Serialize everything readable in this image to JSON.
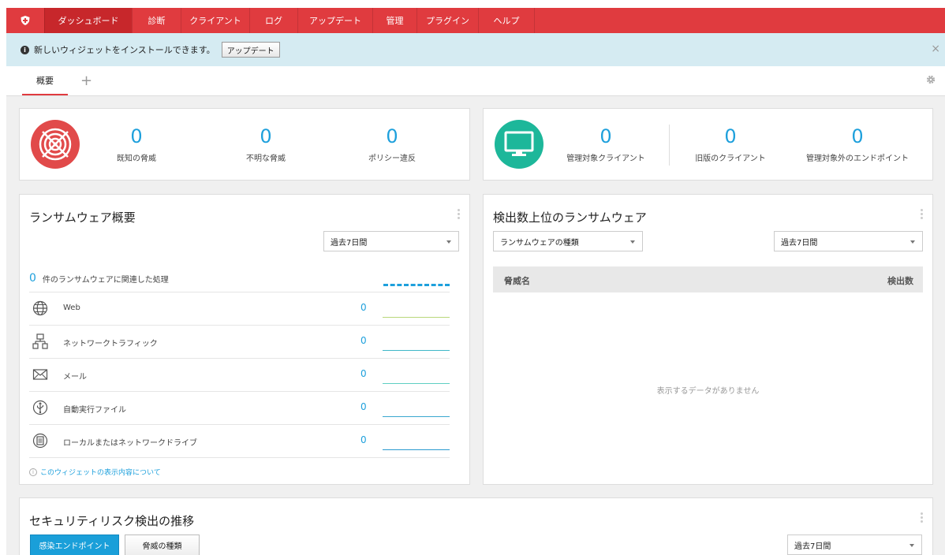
{
  "topnav": {
    "logo_icon": "shield-plus-icon",
    "items": [
      {
        "label": "ダッシュボード",
        "active": true
      },
      {
        "label": "診断"
      },
      {
        "label": "クライアント"
      },
      {
        "label": "ログ"
      },
      {
        "label": "アップデート"
      },
      {
        "label": "管理"
      },
      {
        "label": "プラグイン"
      },
      {
        "label": "ヘルプ"
      }
    ]
  },
  "infobar": {
    "icon": "info-icon",
    "message": "新しいウィジェットをインストールできます。",
    "button_label": "アップデート",
    "close_label": "×"
  },
  "tabs": {
    "overview_label": "概要",
    "add_label": "+"
  },
  "threat_summary": {
    "icon": "radar-icon",
    "stats": [
      {
        "value": "0",
        "label": "既知の脅威"
      },
      {
        "value": "0",
        "label": "不明な脅威"
      },
      {
        "value": "0",
        "label": "ポリシー違反"
      }
    ]
  },
  "client_summary": {
    "icon": "monitor-icon",
    "stats": [
      {
        "value": "0",
        "label": "管理対象クライアント"
      },
      {
        "value": "0",
        "label": "旧版のクライアント"
      },
      {
        "value": "0",
        "label": "管理対象外のエンドポイント"
      }
    ]
  },
  "ransomware_overview": {
    "title": "ランサムウェア概要",
    "period": "過去7日間",
    "total_value": "0",
    "total_label": "件のランサムウェアに関連した処理",
    "rows": [
      {
        "icon": "globe-icon",
        "label": "Web",
        "value": "0",
        "line_color": "#b9d77a"
      },
      {
        "icon": "network-icon",
        "label": "ネットワークトラフィック",
        "value": "0",
        "line_color": "#3fb8c8"
      },
      {
        "icon": "mail-icon",
        "label": "メール",
        "value": "0",
        "line_color": "#5fcfc2"
      },
      {
        "icon": "usb-icon",
        "label": "自動実行ファイル",
        "value": "0",
        "line_color": "#3aa8d0"
      },
      {
        "icon": "drive-icon",
        "label": "ローカルまたはネットワークドライブ",
        "value": "0",
        "line_color": "#2a9ad0"
      }
    ],
    "about_link": "このウィジェットの表示内容について"
  },
  "top_ransomware": {
    "title": "検出数上位のランサムウェア",
    "type_select": "ランサムウェアの種類",
    "period": "過去7日間",
    "col_threat": "脅威名",
    "col_count": "検出数",
    "empty_message": "表示するデータがありません"
  },
  "security_risk": {
    "title": "セキュリティリスク検出の推移",
    "btn_infected": "感染エンドポイント",
    "btn_threat_type": "脅威の種類",
    "period": "過去7日間"
  },
  "colors": {
    "nav_red": "#e03b3f",
    "accent_blue": "#1ea0dc",
    "radar_red": "#e14a4a",
    "monitor_teal": "#1db79a"
  }
}
